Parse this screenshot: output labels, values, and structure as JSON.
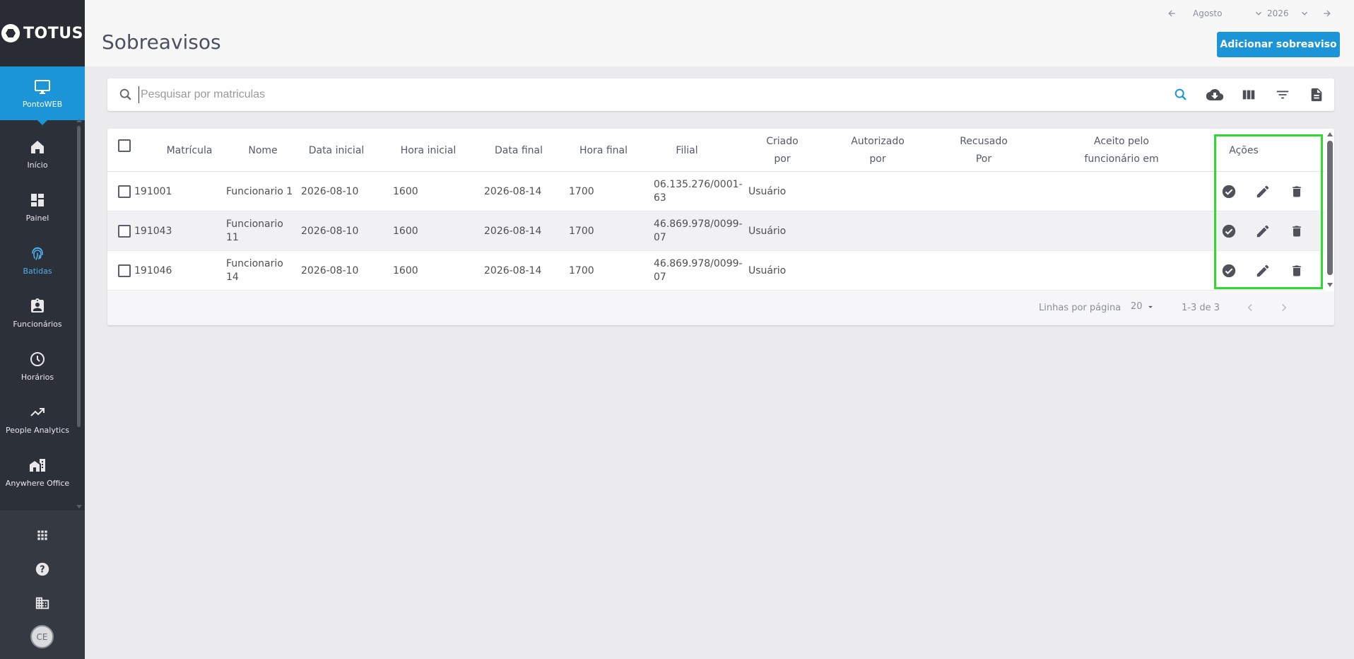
{
  "brand": {
    "name": "TOTUS"
  },
  "nav": {
    "active_module": {
      "label": "PontoWEB",
      "icon": "monitor-icon"
    },
    "items": [
      {
        "label": "Início",
        "icon": "home-icon"
      },
      {
        "label": "Painel",
        "icon": "dashboard-icon"
      },
      {
        "label": "Batidas",
        "icon": "fingerprint-icon"
      },
      {
        "label": "Funcionários",
        "icon": "badge-icon"
      },
      {
        "label": "Horários",
        "icon": "clock-icon"
      },
      {
        "label": "People Analytics",
        "icon": "trending-icon"
      },
      {
        "label": "Anywhere Office",
        "icon": "home-work-icon"
      }
    ],
    "current": "Batidas",
    "bottom": {
      "apps_icon": "apps-grid-icon",
      "help_icon": "help-icon",
      "company_icon": "building-icon",
      "avatar_initials": "CE"
    }
  },
  "header": {
    "title": "Sobreavisos",
    "month": "Agosto",
    "year": "2026",
    "add_button": "Adicionar sobreaviso"
  },
  "search": {
    "placeholder": "Pesquisar por matriculas",
    "value": "",
    "tools": [
      "search-icon",
      "cloud-download-icon",
      "columns-icon",
      "filter-icon",
      "document-icon"
    ]
  },
  "table": {
    "columns": {
      "matricula": "Matrícula",
      "nome": "Nome",
      "data_inicial": "Data inicial",
      "hora_inicial": "Hora inicial",
      "data_final": "Data final",
      "hora_final": "Hora final",
      "filial": "Filial",
      "criado_por": "Criado por",
      "autorizado_por": "Autorizado por",
      "recusado_por": "Recusado Por",
      "aceito_em": "Aceito pelo funcionário em",
      "acoes": "Ações"
    },
    "rows": [
      {
        "matricula": "191001",
        "nome": "Funcionario 1",
        "data_inicial": "2026-08-10",
        "hora_inicial": "1600",
        "data_final": "2026-08-14",
        "hora_final": "1700",
        "filial": "06.135.276/0001-63",
        "criado_por": "Usuário",
        "autorizado_por": "",
        "recusado_por": "",
        "aceito_em": ""
      },
      {
        "matricula": "191043",
        "nome": "Funcionario 11",
        "data_inicial": "2026-08-10",
        "hora_inicial": "1600",
        "data_final": "2026-08-14",
        "hora_final": "1700",
        "filial": "46.869.978/0099-07",
        "criado_por": "Usuário",
        "autorizado_por": "",
        "recusado_por": "",
        "aceito_em": ""
      },
      {
        "matricula": "191046",
        "nome": "Funcionario 14",
        "data_inicial": "2026-08-10",
        "hora_inicial": "1600",
        "data_final": "2026-08-14",
        "hora_final": "1700",
        "filial": "46.869.978/0099-07",
        "criado_por": "Usuário",
        "autorizado_por": "",
        "recusado_por": "",
        "aceito_em": ""
      }
    ],
    "row_actions": [
      "check-circle-icon",
      "edit-icon",
      "delete-icon"
    ],
    "footer": {
      "rows_per_page_label": "Linhas por página",
      "rows_per_page": "20",
      "range": "1-3 de 3"
    }
  },
  "colors": {
    "accent": "#1c94d8",
    "sidebar": "#2c3039",
    "highlight": "#2fd92f"
  }
}
